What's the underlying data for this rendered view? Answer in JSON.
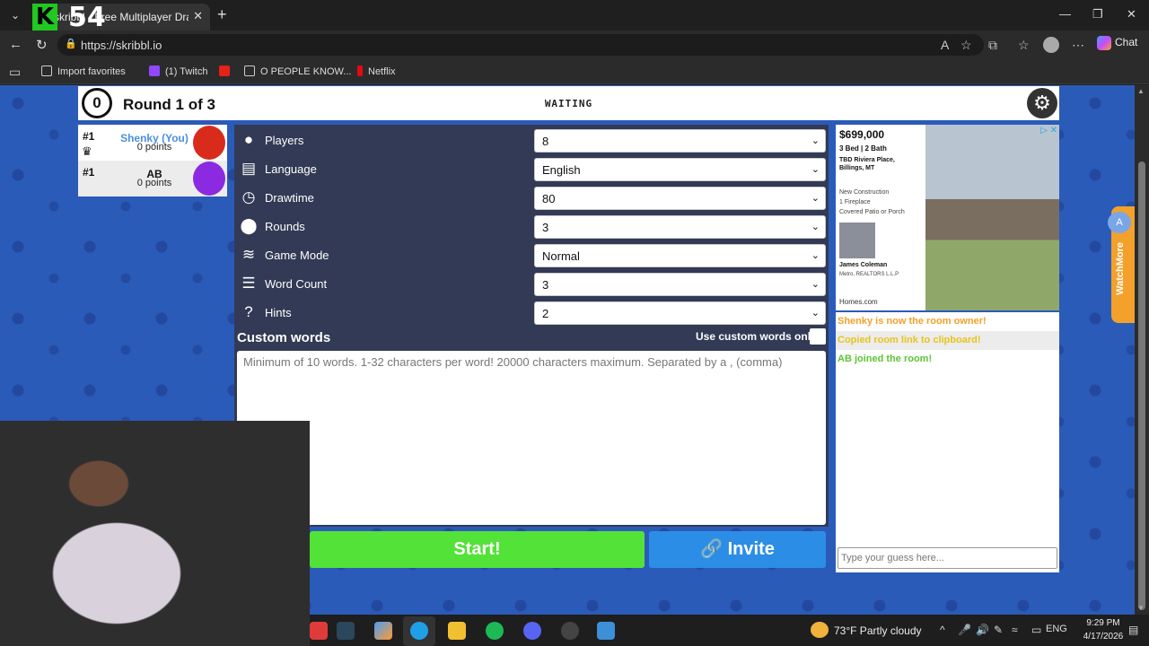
{
  "browser": {
    "tab_title": "skribbl - Free Multiplayer Drawing",
    "overlay_logo_letter": "K",
    "overlay_number": "54",
    "url": "https://skribbl.io",
    "chat_label": "Chat",
    "favorites": [
      "Import favorites",
      "(1) Twitch",
      "O PEOPLE KNOW...",
      "Netflix"
    ]
  },
  "header": {
    "timer": "0",
    "round": "Round 1 of 3",
    "status": "WAITING"
  },
  "players": [
    {
      "rank": "#1",
      "name": "Shenky (You)",
      "points": "0 points",
      "color": "#4a90e2",
      "avatar_color": "#d82b1c"
    },
    {
      "rank": "#1",
      "name": "AB",
      "points": "0 points",
      "color": "#111111",
      "avatar_color": "#8b2ae0"
    }
  ],
  "settings": [
    {
      "label": "Players",
      "value": "8",
      "icon": "person-icon"
    },
    {
      "label": "Language",
      "value": "English",
      "icon": "language-icon"
    },
    {
      "label": "Drawtime",
      "value": "80",
      "icon": "clock-icon"
    },
    {
      "label": "Rounds",
      "value": "3",
      "icon": "rounds-icon"
    },
    {
      "label": "Game Mode",
      "value": "Normal",
      "icon": "gamemode-icon"
    },
    {
      "label": "Word Count",
      "value": "3",
      "icon": "wordcount-icon"
    },
    {
      "label": "Hints",
      "value": "2",
      "icon": "hint-icon"
    }
  ],
  "custom_words": {
    "title": "Custom words",
    "only_label": "Use custom words only",
    "placeholder": "Minimum of 10 words. 1-32 characters per word! 20000 characters maximum. Separated by a , (comma)"
  },
  "buttons": {
    "start": "Start!",
    "invite": "Invite"
  },
  "ad": {
    "price": "$699,000",
    "beds": "3 Bed | 2 Bath",
    "address1": "TBD Riviera Place,",
    "address2": "Billings, MT",
    "feature1": "New Construction",
    "feature2": "1 Fireplace",
    "feature3": "Covered Patio or Porch",
    "agent": "James Coleman",
    "agency": "Metro, REALTORS L.L.P",
    "site": "Homes.com"
  },
  "chat": {
    "messages": [
      {
        "text": "Shenky is now the room owner!",
        "color": "#f0a12b"
      },
      {
        "text": "Copied room link to clipboard!",
        "color": "#e8c41a"
      },
      {
        "text": "AB joined the room!",
        "color": "#5cc534"
      }
    ],
    "placeholder": "Type your guess here..."
  },
  "side_widget": {
    "label": "WatchMore"
  },
  "taskbar": {
    "weather": "73°F  Partly cloudy",
    "lang": "ENG",
    "time": "9:29 PM",
    "date": "4/17/2026"
  }
}
